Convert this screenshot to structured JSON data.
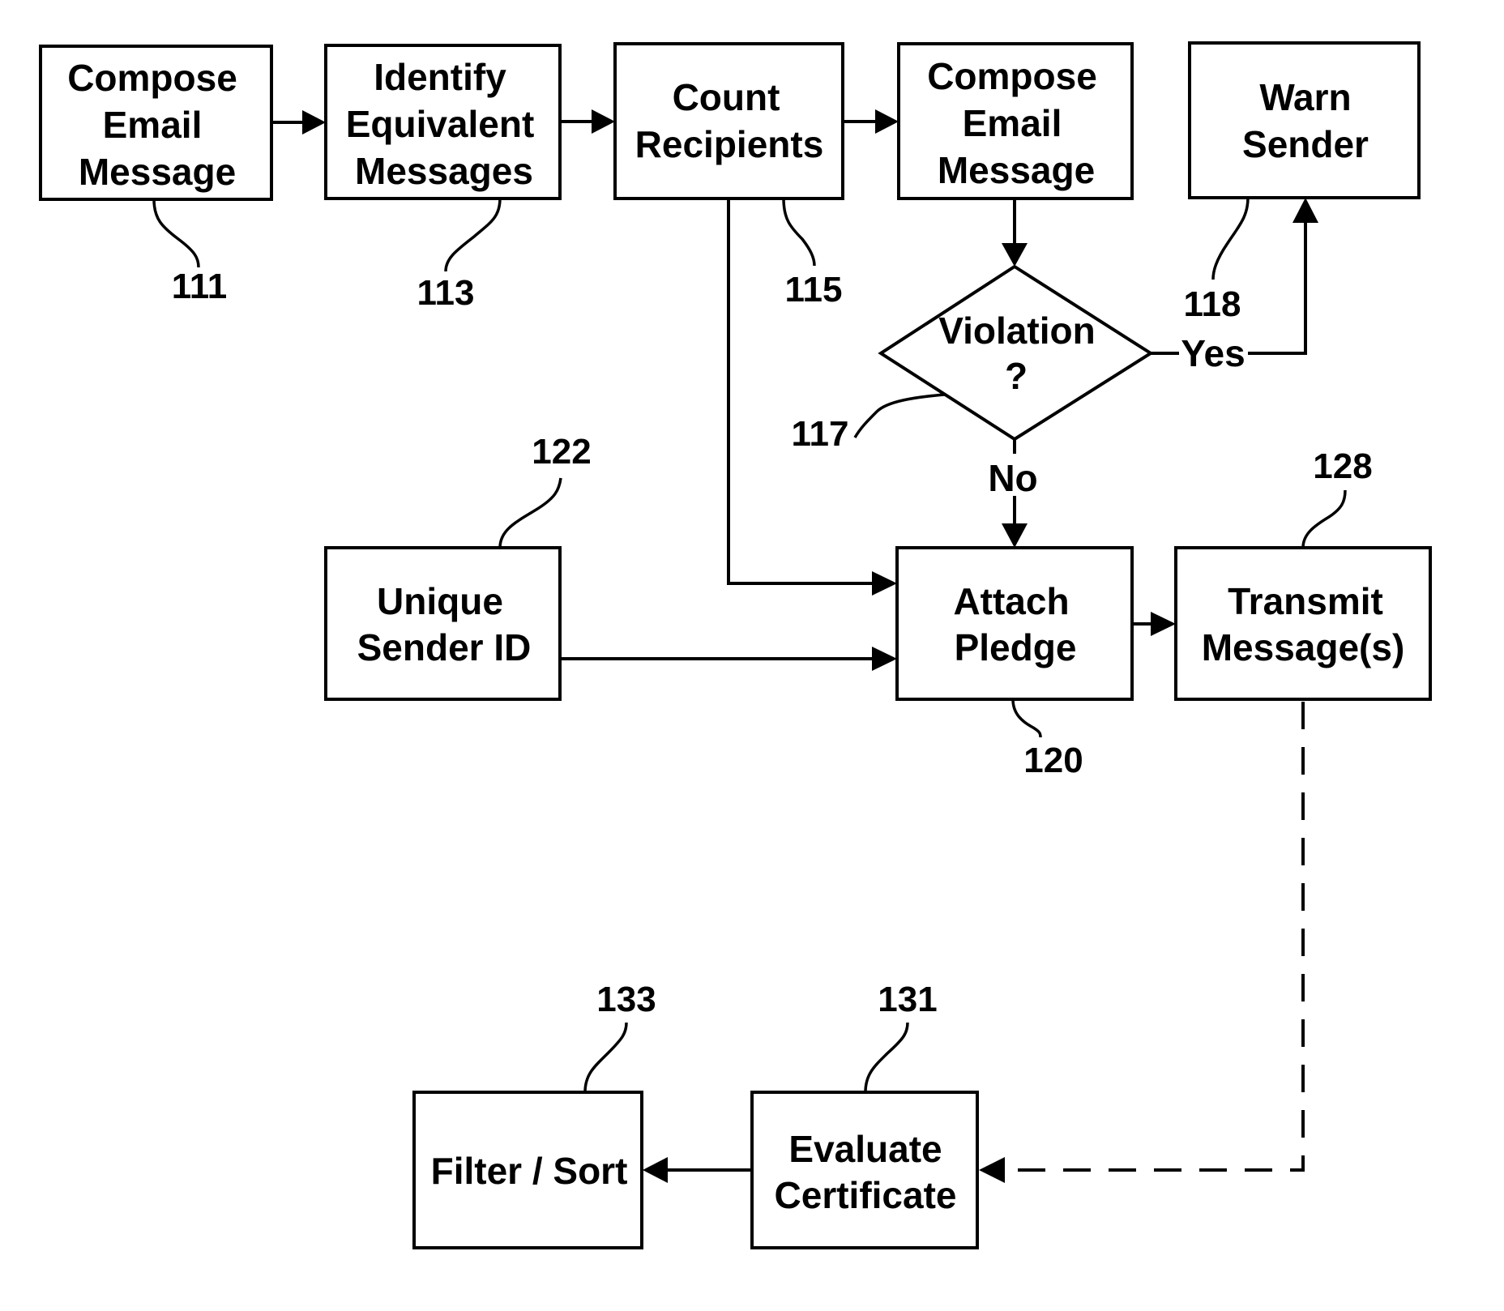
{
  "nodes": {
    "compose_1": {
      "ref": "111",
      "lines": [
        "Compose",
        "Email",
        "Message"
      ]
    },
    "identify": {
      "ref": "113",
      "lines": [
        "Identify",
        "Equivalent",
        "Messages"
      ]
    },
    "count": {
      "ref": "115",
      "lines": [
        "Count",
        "Recipients"
      ]
    },
    "compose_2": {
      "lines": [
        "Compose",
        "Email",
        "Message"
      ]
    },
    "warn": {
      "ref": "118",
      "lines": [
        "Warn",
        "Sender"
      ]
    },
    "violation": {
      "ref": "117",
      "lines": [
        "Violation",
        "?"
      ]
    },
    "unique_id": {
      "ref": "122",
      "lines": [
        "Unique",
        "Sender ID"
      ]
    },
    "attach": {
      "ref": "120",
      "lines": [
        "Attach",
        "Pledge"
      ]
    },
    "transmit": {
      "ref": "128",
      "lines": [
        "Transmit",
        "Message(s)"
      ]
    },
    "evaluate": {
      "ref": "131",
      "lines": [
        "Evaluate",
        "Certificate"
      ]
    },
    "filter": {
      "ref": "133",
      "lines": [
        "Filter / Sort"
      ]
    }
  },
  "edges": {
    "yes_label": "Yes",
    "no_label": "No"
  }
}
